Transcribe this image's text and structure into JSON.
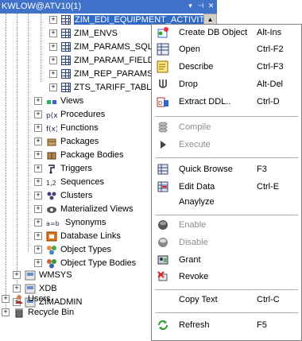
{
  "window": {
    "title": "KWLOW@ATV10(1)",
    "buttons": [
      "▾",
      "⊣",
      "✕"
    ]
  },
  "tree": {
    "tables": [
      {
        "label": "ZIM_EDI_EQUIPMENT_ACTIVIT",
        "selected": true
      },
      {
        "label": "ZIM_ENVS"
      },
      {
        "label": "ZIM_PARAMS_SQLS"
      },
      {
        "label": "ZIM_PARAM_FIELD"
      },
      {
        "label": "ZIM_REP_PARAMS"
      },
      {
        "label": "ZTS_TARIFF_TABLE"
      }
    ],
    "folders": [
      {
        "label": "Views",
        "icon": "views-icon"
      },
      {
        "label": "Procedures",
        "icon": "procedures-icon"
      },
      {
        "label": "Functions",
        "icon": "functions-icon"
      },
      {
        "label": "Packages",
        "icon": "packages-icon"
      },
      {
        "label": "Package Bodies",
        "icon": "package-bodies-icon"
      },
      {
        "label": "Triggers",
        "icon": "triggers-icon"
      },
      {
        "label": "Sequences",
        "icon": "sequences-icon"
      },
      {
        "label": "Clusters",
        "icon": "clusters-icon"
      },
      {
        "label": "Materialized Views",
        "icon": "materialized-views-icon"
      },
      {
        "label": "Synonyms",
        "icon": "synonyms-icon"
      },
      {
        "label": "Database Links",
        "icon": "database-links-icon"
      },
      {
        "label": "Object Types",
        "icon": "object-types-icon"
      },
      {
        "label": "Object Type Bodies",
        "icon": "object-type-bodies-icon"
      }
    ],
    "schemas": [
      {
        "label": "WMSYS"
      },
      {
        "label": "XDB"
      },
      {
        "label": "ZIMADMIN"
      }
    ],
    "roots": [
      {
        "label": "Users",
        "icon": "users-icon"
      },
      {
        "label": "Recycle Bin",
        "icon": "recycle-bin-icon"
      }
    ]
  },
  "menu": {
    "items": [
      {
        "label": "Create DB Object",
        "key": "Alt-Ins",
        "icon": "create-db-object-icon",
        "disabled": false
      },
      {
        "label": "Open",
        "key": "Ctrl-F2",
        "icon": "open-icon",
        "disabled": false
      },
      {
        "label": "Describe",
        "key": "Ctrl-F3",
        "icon": "describe-icon",
        "disabled": false
      },
      {
        "label": "Drop",
        "key": "Alt-Del",
        "icon": "drop-icon",
        "disabled": false
      },
      {
        "label": "Extract DDL..",
        "key": "Ctrl-D",
        "icon": "extract-ddl-icon",
        "disabled": false
      },
      {
        "label": "Compile",
        "key": "",
        "icon": "compile-icon",
        "disabled": true
      },
      {
        "label": "Execute",
        "key": "",
        "icon": "execute-icon",
        "disabled": true
      },
      {
        "label": "Quick Browse",
        "key": "F3",
        "icon": "quick-browse-icon",
        "disabled": false
      },
      {
        "label": "Edit Data",
        "key": "Ctrl-E",
        "icon": "edit-data-icon",
        "disabled": false
      },
      {
        "label": "Anaylyze",
        "key": "",
        "icon": "",
        "disabled": false
      },
      {
        "label": "Enable",
        "key": "",
        "icon": "enable-icon",
        "disabled": true
      },
      {
        "label": "Disable",
        "key": "",
        "icon": "disable-icon",
        "disabled": true
      },
      {
        "label": "Grant",
        "key": "",
        "icon": "grant-icon",
        "disabled": false
      },
      {
        "label": "Revoke",
        "key": "",
        "icon": "revoke-icon",
        "disabled": false
      },
      {
        "label": "Copy Text",
        "key": "Ctrl-C",
        "icon": "",
        "disabled": false
      },
      {
        "label": "Refresh",
        "key": "F5",
        "icon": "refresh-icon",
        "disabled": false
      }
    ]
  },
  "colors": {
    "selection": "#3169c6",
    "title_bar": "#3f72c8",
    "disabled_text": "#8d8d8d"
  }
}
